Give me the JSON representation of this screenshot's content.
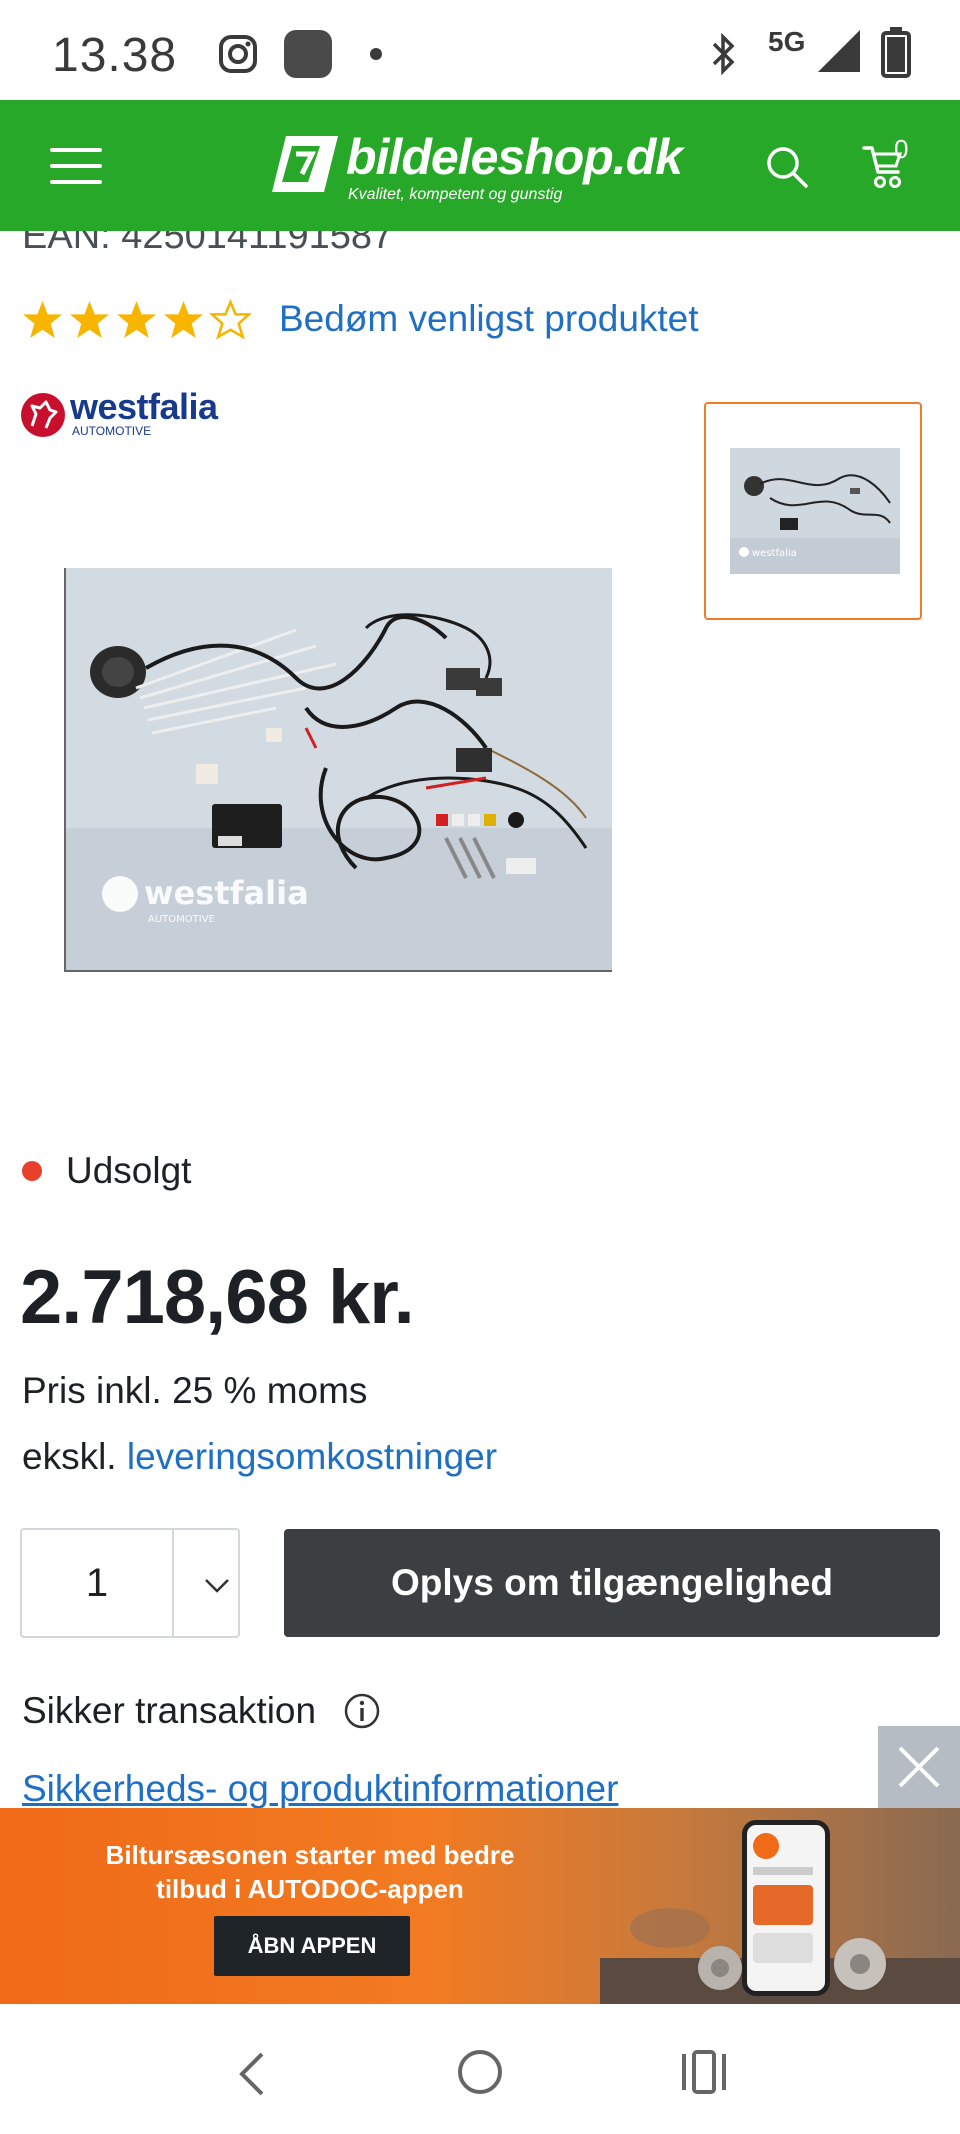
{
  "status_bar": {
    "time": "13.38",
    "network": "5G"
  },
  "header": {
    "logo_text": "bildeleshop.dk",
    "tagline": "Kvalitet, kompetent og gunstig",
    "cart_count": "0"
  },
  "product": {
    "ean": "EAN: 4250141191587",
    "rating_stars": 4,
    "rating_max": 5,
    "rate_link": "Bedøm venligst produktet",
    "brand": "westfalia",
    "brand_sub": "AUTOMOTIVE",
    "image_watermark": "westfalia",
    "stock_status": "Udsolgt",
    "price": "2.718,68 kr.",
    "vat_note": "Pris inkl. 25 % moms",
    "shipping_prefix": "ekskl.",
    "shipping_link": "leveringsomkostninger",
    "quantity": "1",
    "availability_button": "Oplys om tilgængelighed",
    "secure_label": "Sikker transaktion",
    "safety_link": "Sikkerheds- og produktinformationer"
  },
  "ad_banner": {
    "line1": "Biltursæsonen starter med bedre",
    "line2": "tilbud i AUTODOC-appen",
    "button": "ÅBN APPEN"
  },
  "colors": {
    "header_green": "#28a829",
    "link_blue": "#1f6fc5",
    "star_yellow": "#f7b500",
    "sold_out_red": "#e8402a",
    "button_dark": "#3b3f42",
    "thumb_border": "#ef7d2a",
    "ad_orange": "#f06a17"
  }
}
